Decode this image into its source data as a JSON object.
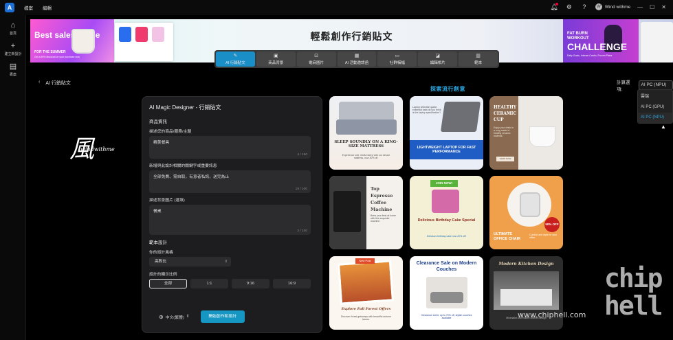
{
  "titlebar": {
    "menu": [
      "檔案",
      "編輯"
    ],
    "user_name": "Wind withme",
    "avatar_initial": "W",
    "window_controls": [
      "—",
      "☐",
      "✕"
    ]
  },
  "sidebar": {
    "items": [
      {
        "label": "首頁",
        "icon": "home-icon",
        "glyph": "⌂"
      },
      {
        "label": "建立新設計",
        "icon": "plus-icon",
        "glyph": "+"
      },
      {
        "label": "專案",
        "icon": "folder-icon",
        "glyph": "▤"
      }
    ]
  },
  "banner": {
    "title": "輕鬆創作行銷貼文",
    "left_ad": {
      "headline": "Best sales purse",
      "tagline": "FOR THE SUMMER",
      "fine": "Get a 50% discount on your purchase now"
    },
    "right_ad": {
      "line1": "FAT BURN",
      "line2": "WORKOUT",
      "headline": "CHALLENGE",
      "fine": "Daily Goals, Intense Cardio, Proven Plans"
    }
  },
  "tabs": [
    {
      "label": "AI 行銷貼文",
      "icon": "pen-icon",
      "glyph": "✎",
      "active": true
    },
    {
      "label": "商品背景",
      "icon": "image-icon",
      "glyph": "▣",
      "active": false
    },
    {
      "label": "電商圖片",
      "icon": "bag-icon",
      "glyph": "⊡",
      "active": false
    },
    {
      "label": "AI 活動邀請函",
      "icon": "calendar-icon",
      "glyph": "▦",
      "active": false
    },
    {
      "label": "社群橫幅",
      "icon": "banner-icon",
      "glyph": "▭",
      "active": false
    },
    {
      "label": "編輯相片",
      "icon": "photo-edit-icon",
      "glyph": "◪",
      "active": false
    },
    {
      "label": "範本",
      "icon": "template-icon",
      "glyph": "▥",
      "active": false
    }
  ],
  "nav": {
    "back_label": "AI 行銷貼文"
  },
  "compute": {
    "label": "計算選項:",
    "selected": "AI PC (NPU)",
    "options": [
      "雲端",
      "AI PC (GPU)",
      "AI PC (NPU)"
    ]
  },
  "watermark": {
    "glyph": "風",
    "script": "windwithme"
  },
  "form": {
    "title": "AI Magic Designer - 行銷貼文",
    "section_product": "商品資訊",
    "product_label": "描述您的商品/服務/主題",
    "product_value": "精美餐具",
    "product_count": "4 / 150",
    "keywords_label": "新增與此設計相關的關鍵字或重要訊息",
    "keywords_value": "全部免費、需自取，有意者私訊，送完為止",
    "keywords_count": "19 / 100",
    "bg_label": "描述背景圖片 (選填)",
    "bg_value": "餐桌",
    "bg_count": "2 / 100",
    "section_template": "範本設計",
    "style_label": "你的設計風格",
    "style_value": "高對比",
    "ratio_label": "設計的顯示比例",
    "ratios": [
      "全部",
      "1:1",
      "9:16",
      "16:9"
    ],
    "active_ratio": "全部",
    "language": "中文(繁體)",
    "generate": "開始創作和設計"
  },
  "explore": {
    "title": "探索流行創意",
    "cards": [
      {
        "title": "SLEEP SOUNDLY ON A KING-SIZE MATTRESS",
        "sub": "Experience soft, restful sleep with our deluxe mattress, now 30% off."
      },
      {
        "title": "LIGHTWEIGHT LAPTOP FOR FAST PERFORMANCE",
        "sub": "Laptop selection guide: essential data do you think is the laptop specification?"
      },
      {
        "title": "HEALTHY CERAMIC CUP",
        "sub": "Enjoy your drink in a mug made of healthy ceramic material.",
        "button": "SHOP NOW"
      },
      {
        "title": "Top Espresso Coffee Machine",
        "sub": "Brew your best at home with this exquisite machine."
      },
      {
        "title": "Delicious Birthday Cake Special",
        "badge": "JOIN NOW!",
        "sub": "Delicious birthday cake now 20% off!"
      },
      {
        "title": "ULTIMATE OFFICE CHAIR",
        "badge": "50% OFF",
        "sub": "Comfort and style for your office."
      },
      {
        "title": "Explore Fall Forest Offers",
        "badge": "New Post",
        "sub": "Discover forest getaways with beautiful autumn leaves."
      },
      {
        "title": "Clearance Sale on Modern Couches",
        "sub": "Clearance event, up to 70% off, stylish couches available"
      },
      {
        "title": "Modern Kitchen Design",
        "sub": "Minimalist and modern kitchen design"
      }
    ]
  },
  "watermarks": {
    "site": "www.chiphell.com",
    "logo": "chip hell"
  },
  "colors": {
    "accent": "#1a8ec7",
    "explore_title": "#2ba6e0",
    "selected_option": "#2ba6e0"
  }
}
